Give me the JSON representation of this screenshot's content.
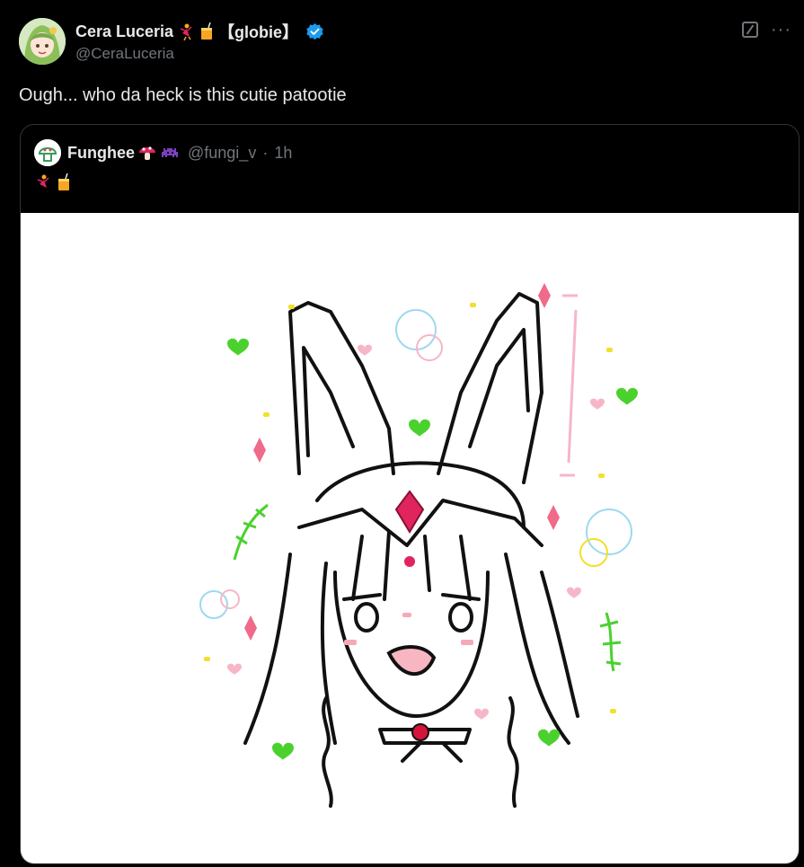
{
  "tweet": {
    "display_name": "Cera Luceria",
    "name_suffix": "【globie】",
    "handle": "@CeraLuceria",
    "text": "Ough... who da heck is this cutie patootie",
    "verified_color": "#1d9bf0"
  },
  "quoted": {
    "display_name": "Funghee",
    "handle": "@fungi_v",
    "separator": "·",
    "time": "1h"
  },
  "icons": {
    "grok": "grok-icon",
    "more": "more-icon",
    "more_glyph": "···"
  },
  "colors": {
    "background": "#000000",
    "text_primary": "#e7e9ea",
    "text_secondary": "#71767b",
    "border": "#2f3336"
  }
}
